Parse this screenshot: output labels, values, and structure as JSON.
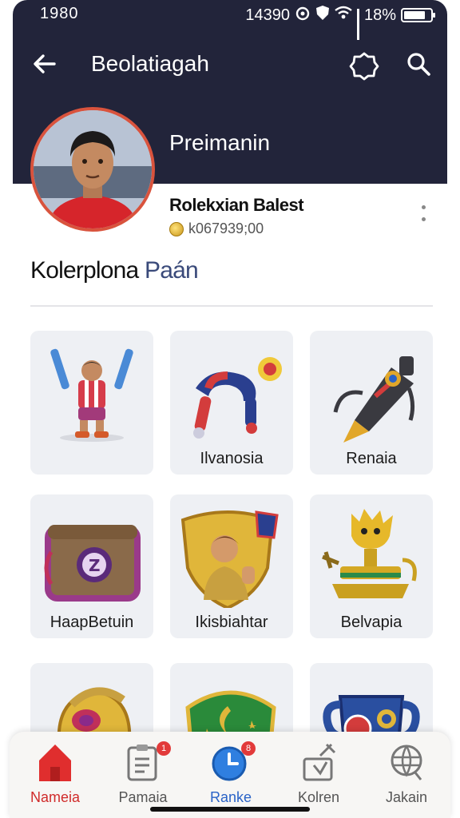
{
  "status_bar": {
    "time": "1980",
    "center_time": "14390",
    "battery_percent": "18%",
    "battery_level": 0.82
  },
  "topbar": {
    "title": "Beolatiagah",
    "back_icon": "arrow-left-icon",
    "badge_icon": "badge-icon",
    "search_icon": "search-icon"
  },
  "profile": {
    "name": "Preimanin",
    "subtitle": "Rolekxian Balest",
    "coins": "k067939;00"
  },
  "section": {
    "title_a": "Kolerplona",
    "title_b": "Paán"
  },
  "grid": {
    "items": [
      {
        "label": "",
        "icon": "player-figure-icon"
      },
      {
        "label": "Ilvanosia",
        "icon": "robot-arm-icon"
      },
      {
        "label": "Renaia",
        "icon": "rocket-tool-icon"
      },
      {
        "label": "HaapBetuin",
        "icon": "treasure-chest-icon"
      },
      {
        "label": "Ikisbiahtar",
        "icon": "hero-shield-icon"
      },
      {
        "label": "Belvapia",
        "icon": "golden-trophy-icon"
      },
      {
        "label": "",
        "icon": "golden-helmet-icon"
      },
      {
        "label": "",
        "icon": "green-shield-icon"
      },
      {
        "label": "",
        "icon": "blue-cup-icon"
      }
    ]
  },
  "bottom_nav": {
    "items": [
      {
        "label": "Nameia",
        "icon": "home-icon",
        "badge": ""
      },
      {
        "label": "Pamaia",
        "icon": "document-icon",
        "badge": "1"
      },
      {
        "label": "Ranke",
        "icon": "clock-icon",
        "badge": "8"
      },
      {
        "label": "Kolren",
        "icon": "tools-icon",
        "badge": ""
      },
      {
        "label": "Jakain",
        "icon": "globe-icon",
        "badge": ""
      }
    ]
  },
  "colors": {
    "header": "#22243a",
    "active_nav": "#d02b2b",
    "blue_nav": "#2a63c7",
    "avatar_border": "#d9533d"
  }
}
